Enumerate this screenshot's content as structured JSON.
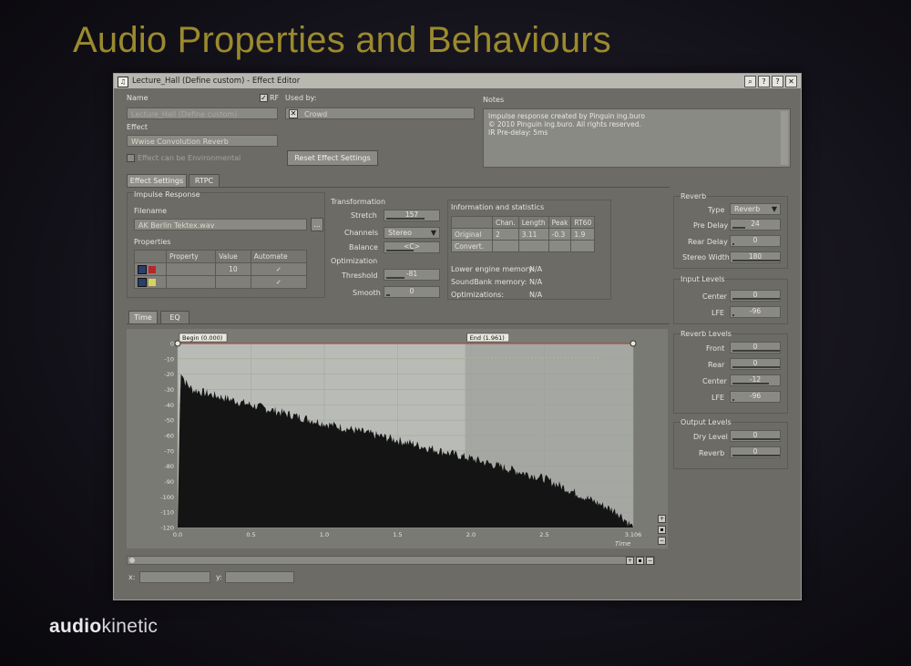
{
  "slide": {
    "title": "Audio Properties and Behaviours",
    "logo_bold": "audio",
    "logo_rest": "kinetic"
  },
  "window": {
    "title": "Lecture_Hall (Define custom) - Effect Editor",
    "title_buttons": [
      "⌕",
      "?",
      "?",
      "✕"
    ]
  },
  "top": {
    "name_label": "Name",
    "name_value": "Lecture_Hall (Define custom)",
    "rf_label": "RF",
    "effect_label": "Effect",
    "effect_value": "Wwise Convolution Reverb",
    "env_checkbox_label": "Effect can be Environmental",
    "used_by_label": "Used by:",
    "used_by_value": "Crowd",
    "reset_button": "Reset Effect Settings",
    "notes_label": "Notes",
    "notes_lines": [
      "Impulse response created by Pinguin ing.buro",
      "© 2010 Pinguin ing.buro. All rights reserved.",
      "IR Pre-delay: 5ms"
    ]
  },
  "tabs": [
    "Effect Settings",
    "RTPC"
  ],
  "impulse": {
    "group_label": "Impulse Response",
    "filename_label": "Filename",
    "filename_value": "AK Berlin Tektex.wav",
    "browse_button": "...",
    "properties_label": "Properties",
    "prop_headers": [
      "Property",
      "Value",
      "Automate"
    ],
    "prop_rows": [
      {
        "value": "10",
        "color": "#b8262b",
        "checked": true
      },
      {
        "value": "",
        "color": "#d8d35a",
        "checked": true
      }
    ]
  },
  "transformation": {
    "group_label": "Transformation",
    "stretch_label": "Stretch",
    "stretch_value": "157",
    "channels_label": "Channels",
    "channels_value": "Stereo",
    "balance_label": "Balance",
    "balance_value": "<C>",
    "optimization_label": "Optimization",
    "threshold_label": "Threshold",
    "threshold_value": "-81",
    "smooth_label": "Smooth",
    "smooth_value": "0"
  },
  "info": {
    "group_label": "Information and statistics",
    "headers": [
      "",
      "Chan.",
      "Length",
      "Peak",
      "RT60"
    ],
    "rows": [
      [
        "Original",
        "2",
        "3.11",
        "-0.3",
        "1.9"
      ],
      [
        "Convert.",
        "",
        "",
        "",
        ""
      ]
    ],
    "lower_engine_label": "Lower engine memory:",
    "lower_engine_value": "N/A",
    "soundbank_label": "SoundBank memory:",
    "soundbank_value": "N/A",
    "optimizations_label": "Optimizations:",
    "optimizations_value": "N/A"
  },
  "reverb": {
    "group_label": "Reverb",
    "type_label": "Type",
    "type_value": "Reverb",
    "pre_delay_label": "Pre Delay",
    "pre_delay_value": "24",
    "rear_delay_label": "Rear Delay",
    "rear_delay_value": "0",
    "stereo_width_label": "Stereo Width",
    "stereo_width_value": "180"
  },
  "input_levels": {
    "group_label": "Input Levels",
    "center_label": "Center",
    "center_value": "0",
    "lfe_label": "LFE",
    "lfe_value": "-96"
  },
  "reverb_levels": {
    "group_label": "Reverb Levels",
    "front_label": "Front",
    "front_value": "0",
    "rear_label": "Rear",
    "rear_value": "0",
    "center_label": "Center",
    "center_value": "-12",
    "lfe_label": "LFE",
    "lfe_value": "-96"
  },
  "output_levels": {
    "group_label": "Output Levels",
    "dry_label": "Dry Level",
    "dry_value": "0",
    "reverb_label": "Reverb",
    "reverb_value": "0"
  },
  "graph_tabs": [
    "Time",
    "EQ"
  ],
  "graph": {
    "begin_marker": "Begin (0.000)",
    "end_marker": "End (1.961)",
    "x_label": "Time",
    "x_label_text": "x:",
    "y_label_text": "y:"
  },
  "chart_data": {
    "type": "area",
    "title": "",
    "xlabel": "Time",
    "ylabel": "",
    "x_ticks": [
      "0.0",
      "0.5",
      "1.0",
      "1.5",
      "2.0",
      "2.5",
      "3.106"
    ],
    "y_ticks": [
      "0",
      "-10",
      "-20",
      "-30",
      "-40",
      "-50",
      "-60",
      "-70",
      "-80",
      "-90",
      "-100",
      "-110",
      "-120"
    ],
    "xlim": [
      0,
      3.106
    ],
    "ylim": [
      -120,
      0
    ],
    "begin_x": 0.0,
    "end_x": 1.961,
    "series": [
      {
        "x": [
          0.0,
          0.02,
          0.05,
          0.1,
          0.5,
          1.0,
          1.5,
          2.0,
          2.5,
          3.0,
          3.106
        ],
        "values": [
          -120,
          -17,
          -25,
          -30,
          -40,
          -52,
          -63,
          -75,
          -88,
          -110,
          -120
        ]
      }
    ],
    "colors": {
      "fill": "#141414",
      "bg": "#b8bbb6",
      "selection": "#a8aba6",
      "line": "#b23a2a"
    }
  }
}
